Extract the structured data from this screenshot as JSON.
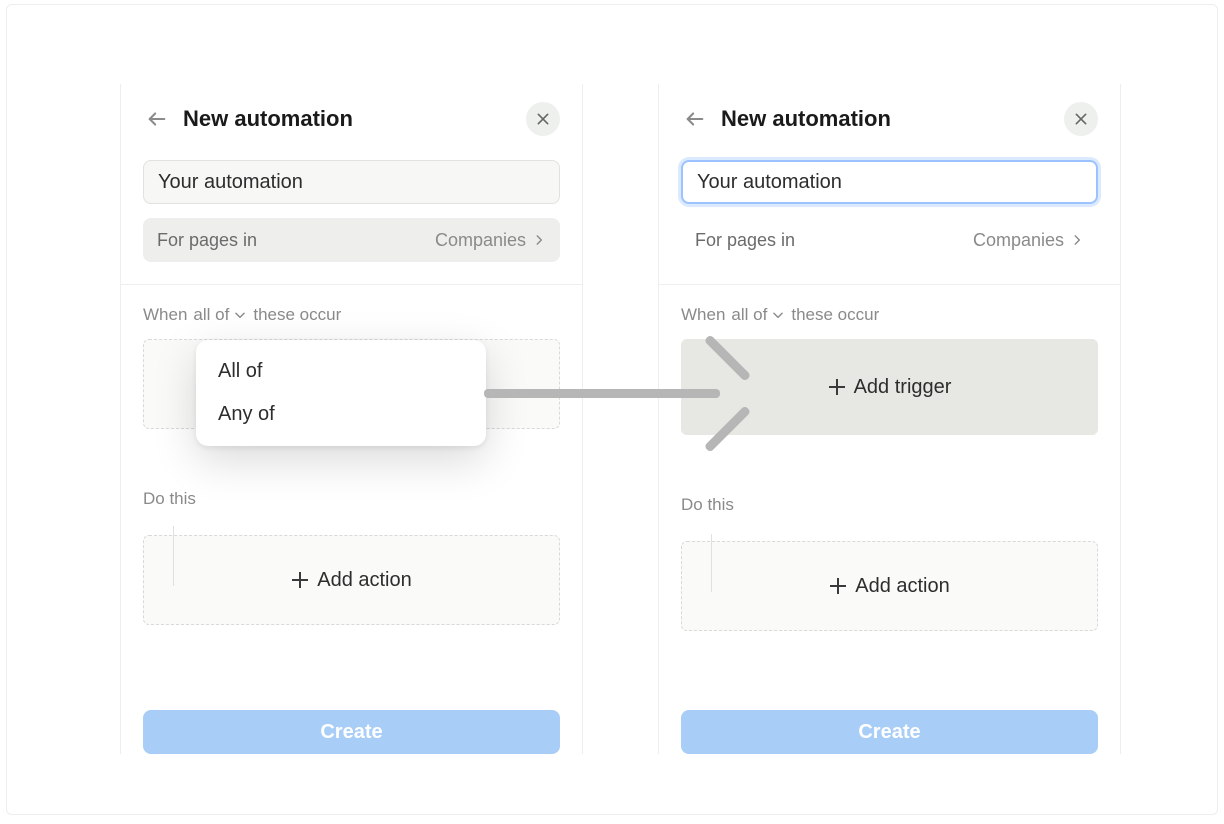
{
  "header": {
    "title": "New automation"
  },
  "name_input": {
    "value": "Your automation"
  },
  "scope": {
    "label": "For pages in",
    "value": "Companies"
  },
  "when": {
    "prefix": "When",
    "mode": "all of",
    "suffix": "these occur"
  },
  "dropdown": {
    "options": [
      "All of",
      "Any of"
    ]
  },
  "trigger_box": {
    "add_label": "Add trigger"
  },
  "do_label": "Do this",
  "action_box": {
    "add_label": "Add action"
  },
  "create_button": "Create"
}
